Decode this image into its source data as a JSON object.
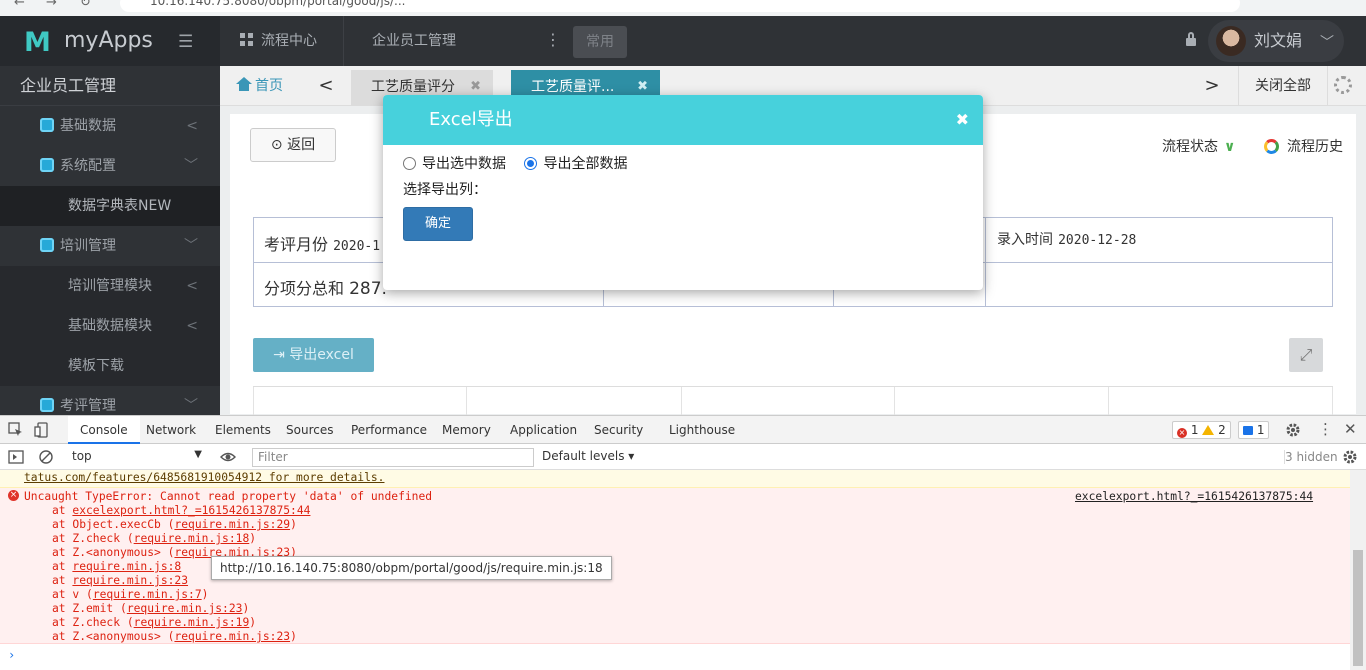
{
  "browser": {
    "url": "10.16.140.75:8080/obpm/portal/good/js/..."
  },
  "app": {
    "logo": "myApps",
    "top_nav": {
      "process_center": "流程中心",
      "employee_mgmt": "企业员工管理",
      "common": "常用"
    },
    "user": {
      "name": "刘文娟"
    }
  },
  "sidebar": {
    "title": "企业员工管理",
    "items": [
      {
        "label": "基础数据",
        "level": "top",
        "arrow": "<"
      },
      {
        "label": "系统配置",
        "level": "top",
        "arrow": "﹀"
      },
      {
        "label": "数据字典表NEW",
        "level": "sub",
        "arrow": ""
      },
      {
        "label": "培训管理",
        "level": "top",
        "arrow": "﹀"
      },
      {
        "label": "培训管理模块",
        "level": "sub",
        "arrow": "<"
      },
      {
        "label": "基础数据模块",
        "level": "sub",
        "arrow": "<"
      },
      {
        "label": "模板下载",
        "level": "sub",
        "arrow": ""
      },
      {
        "label": "考评管理",
        "level": "top",
        "arrow": "﹀"
      }
    ]
  },
  "tabs": {
    "home": "首页",
    "items": [
      {
        "label": "工艺质量评分",
        "active": false
      },
      {
        "label": "工艺质量评...",
        "active": true
      }
    ],
    "close_all": "关闭全部"
  },
  "main": {
    "back": "返回",
    "flow_state": "流程状态",
    "flow_history": "流程历史",
    "eval_month_label": "考评月份",
    "eval_month_value": "2020-1",
    "entry_time_label": "录入时间",
    "entry_time_value": "2020-12-28",
    "sum_label": "分项分总和",
    "sum_value": "287.",
    "export_button": "导出excel"
  },
  "modal": {
    "title": "Excel导出",
    "option_selected": "导出选中数据",
    "option_all": "导出全部数据",
    "selected_option": "option_all",
    "columns_label": "选择导出列：",
    "confirm": "确定"
  },
  "devtools": {
    "tabs": [
      "Console",
      "Network",
      "Elements",
      "Sources",
      "Performance",
      "Memory",
      "Application",
      "Security",
      "Lighthouse"
    ],
    "active_tab": "Console",
    "errors": "1",
    "warnings": "2",
    "messages": "1",
    "context": "top",
    "filter_placeholder": "Filter",
    "levels": "Default levels ▾",
    "hidden": "3 hidden",
    "warn_text": "tatus.com/features/6485681910054912 for more details.",
    "error_message": "Uncaught TypeError: Cannot read property 'data' of undefined",
    "error_source": "excelexport.html?_=1615426137875:44",
    "stack": [
      {
        "fn": "at ",
        "link": "excelexport.html?_=1615426137875:44",
        "paren": false
      },
      {
        "fn": "at Object.execCb ",
        "link": "require.min.js:29",
        "paren": true
      },
      {
        "fn": "at Z.check ",
        "link": "require.min.js:18",
        "paren": true
      },
      {
        "fn": "at Z.<anonymous> ",
        "link": "require.min.js:23",
        "paren": true
      },
      {
        "fn": "at ",
        "link": "require.min.js:8",
        "paren": false
      },
      {
        "fn": "at ",
        "link": "require.min.js:23",
        "paren": false
      },
      {
        "fn": "at v ",
        "link": "require.min.js:7",
        "paren": true
      },
      {
        "fn": "at Z.emit ",
        "link": "require.min.js:23",
        "paren": true
      },
      {
        "fn": "at Z.check ",
        "link": "require.min.js:19",
        "paren": true
      },
      {
        "fn": "at Z.<anonymous> ",
        "link": "require.min.js:23",
        "paren": true
      }
    ],
    "tooltip": "http://10.16.140.75:8080/obpm/portal/good/js/require.min.js:18"
  },
  "colors": {
    "brand_teal": "#3fc9c3",
    "modal_header": "#47d1dc",
    "active_tab": "#2e8fa5",
    "confirm_button": "#337ab7",
    "error_red": "#d93025"
  }
}
